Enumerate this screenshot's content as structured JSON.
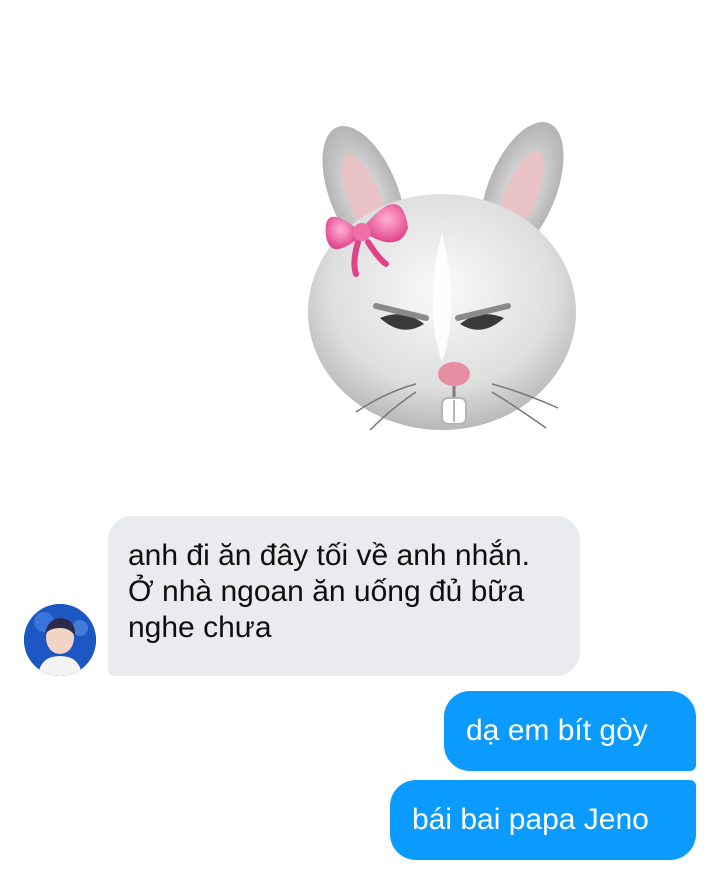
{
  "sticker": {
    "icon": "angry-bunny-memoji-icon",
    "bow_color": "#f06fa8"
  },
  "contact": {
    "avatar_icon": "contact-avatar"
  },
  "messages": [
    {
      "direction": "incoming",
      "text": "anh đi ăn đây tối về anh nhắn. Ở nhà ngoan ăn uống đủ bữa nghe chưa"
    },
    {
      "direction": "outgoing",
      "text": "dạ em bít gòy"
    },
    {
      "direction": "outgoing",
      "text": "bái bai papa Jeno"
    }
  ],
  "colors": {
    "incoming_bubble": "#e9ebee",
    "outgoing_bubble": "#0b9bff",
    "outgoing_text": "#ffffff"
  }
}
